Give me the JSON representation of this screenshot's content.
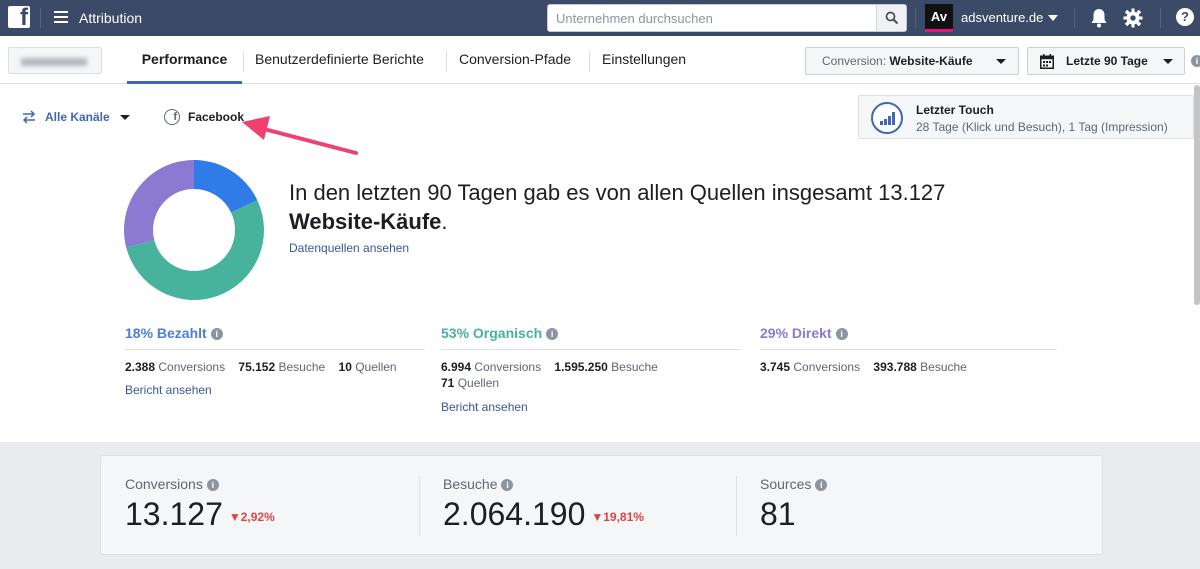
{
  "topbar": {
    "app_title": "Attribution",
    "search_placeholder": "Unternehmen durchsuchen",
    "account_logo_text": "Av",
    "account_name": "adsventure.de"
  },
  "nav": {
    "tabs": [
      {
        "label": "Performance",
        "active": true
      },
      {
        "label": "Benutzerdefinierte Berichte",
        "active": false
      },
      {
        "label": "Conversion-Pfade",
        "active": false
      },
      {
        "label": "Einstellungen",
        "active": false
      }
    ],
    "conversion_prefix": "Conversion:",
    "conversion_value": "Website-Käufe",
    "date_range": "Letzte 90 Tage"
  },
  "channels": {
    "all_label": "Alle Kanäle",
    "facebook_label": "Facebook"
  },
  "attribution_model": {
    "title": "Letzter Touch",
    "subtitle": "28 Tage (Klick und Besuch), 1 Tag (Impression)"
  },
  "headline": {
    "text_before": "In den letzten 90 Tagen gab es von allen Quellen insgesamt 13.127 ",
    "text_bold": "Website-Käufe",
    "text_after": ".",
    "link": "Datenquellen ansehen"
  },
  "donut": {
    "segments": [
      {
        "name": "Bezahlt",
        "percent": 18,
        "color": "#2f7be8"
      },
      {
        "name": "Organisch",
        "percent": 53,
        "color": "#47b39d"
      },
      {
        "name": "Direkt",
        "percent": 29,
        "color": "#8c79d2"
      }
    ]
  },
  "stats": {
    "paid": {
      "title": "18% Bezahlt",
      "color": "#4a7fd6",
      "conversions": "2.388",
      "conversions_label": "Conversions",
      "visits": "75.152",
      "visits_label": "Besuche",
      "sources": "10",
      "sources_label": "Quellen",
      "link": "Bericht ansehen"
    },
    "organic": {
      "title": "53% Organisch",
      "color": "#47b39d",
      "conversions": "6.994",
      "conversions_label": "Conversions",
      "visits": "1.595.250",
      "visits_label": "Besuche",
      "sources": "71",
      "sources_label": "Quellen",
      "link": "Bericht ansehen"
    },
    "direct": {
      "title": "29% Direkt",
      "color": "#8c79d2",
      "conversions": "3.745",
      "conversions_label": "Conversions",
      "visits": "393.788",
      "visits_label": "Besuche"
    }
  },
  "summary": {
    "conversions": {
      "label": "Conversions",
      "value": "13.127",
      "delta": "▼2,92%"
    },
    "visits": {
      "label": "Besuche",
      "value": "2.064.190",
      "delta": "▼19,81%"
    },
    "sources": {
      "label": "Sources",
      "value": "81"
    }
  },
  "colors": {
    "topbar": "#3b4a66",
    "accent": "#4267b2",
    "arrow": "#f0406f",
    "negative": "#e04545"
  }
}
